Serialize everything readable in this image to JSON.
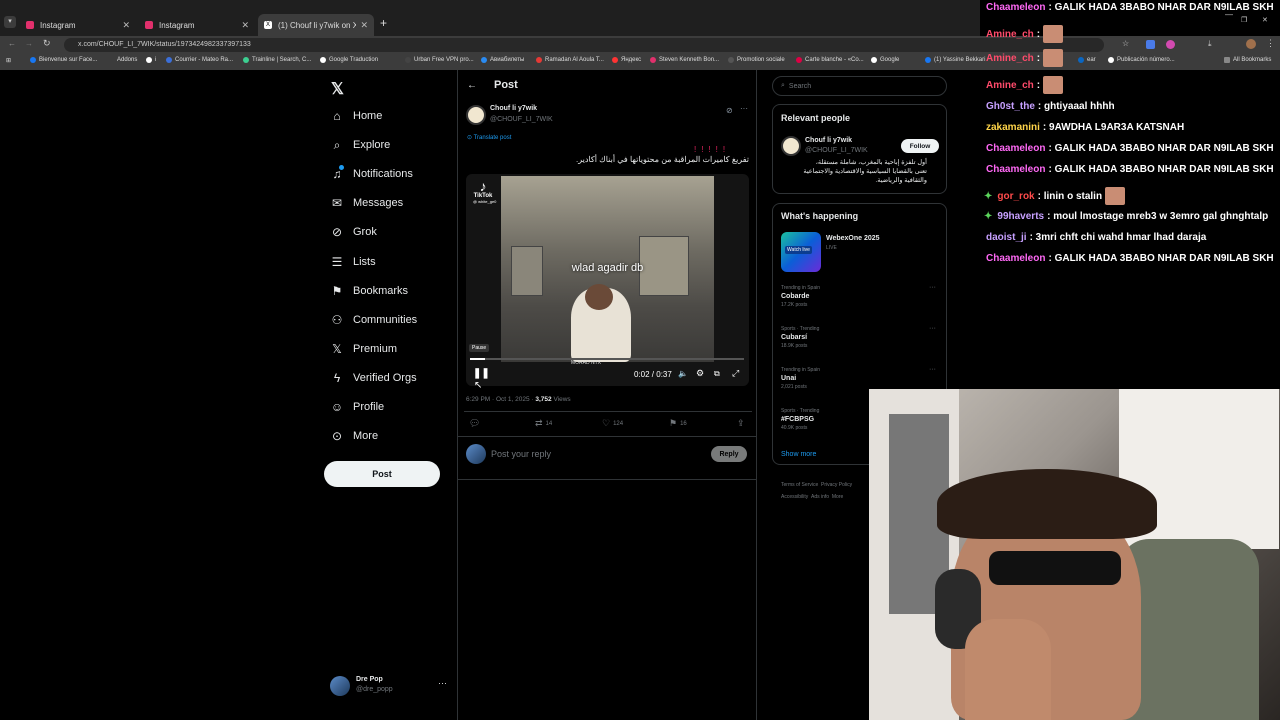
{
  "tabs": [
    {
      "title": "Instagram"
    },
    {
      "title": "Instagram"
    },
    {
      "title": "(1) Chouf li y7wik on X: \""
    }
  ],
  "url": "x.com/CHOUF_LI_7WIK/status/1973424982337397133",
  "bookmarks": [
    "Bienvenue sur Face...",
    "Addons",
    "i",
    "Courrier - Mateo Ra...",
    "Trainline | Search, C...",
    "Google Traduction",
    "Urban Free VPN pro...",
    "Авиабилеты",
    "Ramadan Al Aoula T...",
    "Яндекс",
    "Steven Kenneth Bon...",
    "Promotion sociale",
    "Carte blanche - «Co...",
    "Google",
    "(1) Yassine Bekkari",
    "ear",
    "Publicación número...",
    "All Bookmarks"
  ],
  "sidebar": {
    "items": [
      {
        "label": "Home",
        "icon": "home-icon"
      },
      {
        "label": "Explore",
        "icon": "search-icon"
      },
      {
        "label": "Notifications",
        "icon": "bell-icon"
      },
      {
        "label": "Messages",
        "icon": "mail-icon"
      },
      {
        "label": "Grok",
        "icon": "grok-icon"
      },
      {
        "label": "Lists",
        "icon": "list-icon"
      },
      {
        "label": "Bookmarks",
        "icon": "bookmark-icon"
      },
      {
        "label": "Communities",
        "icon": "people-icon"
      },
      {
        "label": "Premium",
        "icon": "x-icon"
      },
      {
        "label": "Verified Orgs",
        "icon": "lightning-icon"
      },
      {
        "label": "Profile",
        "icon": "person-icon"
      },
      {
        "label": "More",
        "icon": "more-icon"
      }
    ],
    "post_label": "Post",
    "account": {
      "name": "Dre Pop",
      "handle": "@dre_popp"
    }
  },
  "post": {
    "header": "Post",
    "author": "Chouf li y7wik",
    "handle": "@CHOUF_LI_7WIK",
    "translate": "Translate post",
    "text": "تفريغ كاميرات المراقبة من محتوياتها في أبناك أكادير.",
    "video": {
      "badge": "TikTok",
      "badge_user": "@ white_ge0",
      "caption": "wlad agadir db",
      "watermark": "MORAD NTX",
      "pause_tooltip": "Pause",
      "time": "0:02 / 0:37",
      "progress": 0.054
    },
    "timestamp": "6:29 PM · Oct 1, 2025 · ",
    "views": "3,752",
    "views_label": " Views",
    "reposts": "14",
    "likes": "124",
    "bookmarks": "16",
    "reply_placeholder": "Post your reply",
    "reply_button": "Reply"
  },
  "search_placeholder": "Search",
  "relevant": {
    "title": "Relevant people",
    "name": "Chouf li y7wik",
    "handle": "@CHOUF_LI_7WIK",
    "follow": "Follow",
    "bio": "أول تلفزة إباحية بالمغرب، شاملة مستقلة، تعنى بالقضايا السياسية والاقتصادية والاجتماعية والثقافية والرياضية."
  },
  "happening": {
    "title": "What's happening",
    "event": {
      "name": "WebexOne 2025",
      "status": "LIVE",
      "thumb_text": "Watch live"
    },
    "trends": [
      {
        "context": "Trending in Spain",
        "name": "Cobarde",
        "posts": "17.2K posts"
      },
      {
        "context": "Sports · Trending",
        "name": "Cubarsí",
        "posts": "18.9K posts"
      },
      {
        "context": "Trending in Spain",
        "name": "Unai",
        "posts": "2,021 posts"
      },
      {
        "context": "Sports · Trending",
        "name": "#FCBPSG",
        "posts": "40.9K posts"
      }
    ],
    "show_more": "Show more"
  },
  "footer": [
    "Terms of Service",
    "Privacy Policy",
    "Accessibility",
    "Ads info",
    "More"
  ],
  "chat": [
    {
      "user": "Chaameleon",
      "color": "#ff69f5",
      "text": ": GALIK HADA 3BABO NHAR DAR N9ILAB SKH"
    },
    {
      "user": "Amine_ch",
      "color": "#ff4b6b",
      "text": ":"
    },
    {
      "user": "Amine_ch",
      "color": "#ff4b6b",
      "text": ":"
    },
    {
      "user": "Amine_ch",
      "color": "#ff4b6b",
      "text": ":"
    },
    {
      "user": "Gh0st_the",
      "color": "#c7a0ff",
      "text": ": ghtiyaaal hhhh"
    },
    {
      "user": "zakamanini",
      "color": "#ffd54a",
      "text": ": 9AWDHA L9AR3A KATSNAH"
    },
    {
      "user": "Chaameleon",
      "color": "#ff69f5",
      "text": ": GALIK HADA 3BABO NHAR DAR N9ILAB SKH"
    },
    {
      "user": "Chaameleon",
      "color": "#ff69f5",
      "text": ": GALIK HADA 3BABO NHAR DAR N9ILAB SKH"
    },
    {
      "user": "gor_rok",
      "color": "#ff4b4b",
      "text": ": linin o stalin"
    },
    {
      "user": "99haverts",
      "color": "#c7a0ff",
      "text": ": moul lmostage mreb3 w 3emro gal ghnghtalp"
    },
    {
      "user": "daoist_ji",
      "color": "#c7a0ff",
      "text": ": 3mri chft chi wahd hmar lhad daraja"
    },
    {
      "user": "Chaameleon",
      "color": "#ff69f5",
      "text": ": GALIK HADA 3BABO NHAR DAR N9ILAB SKH"
    }
  ]
}
